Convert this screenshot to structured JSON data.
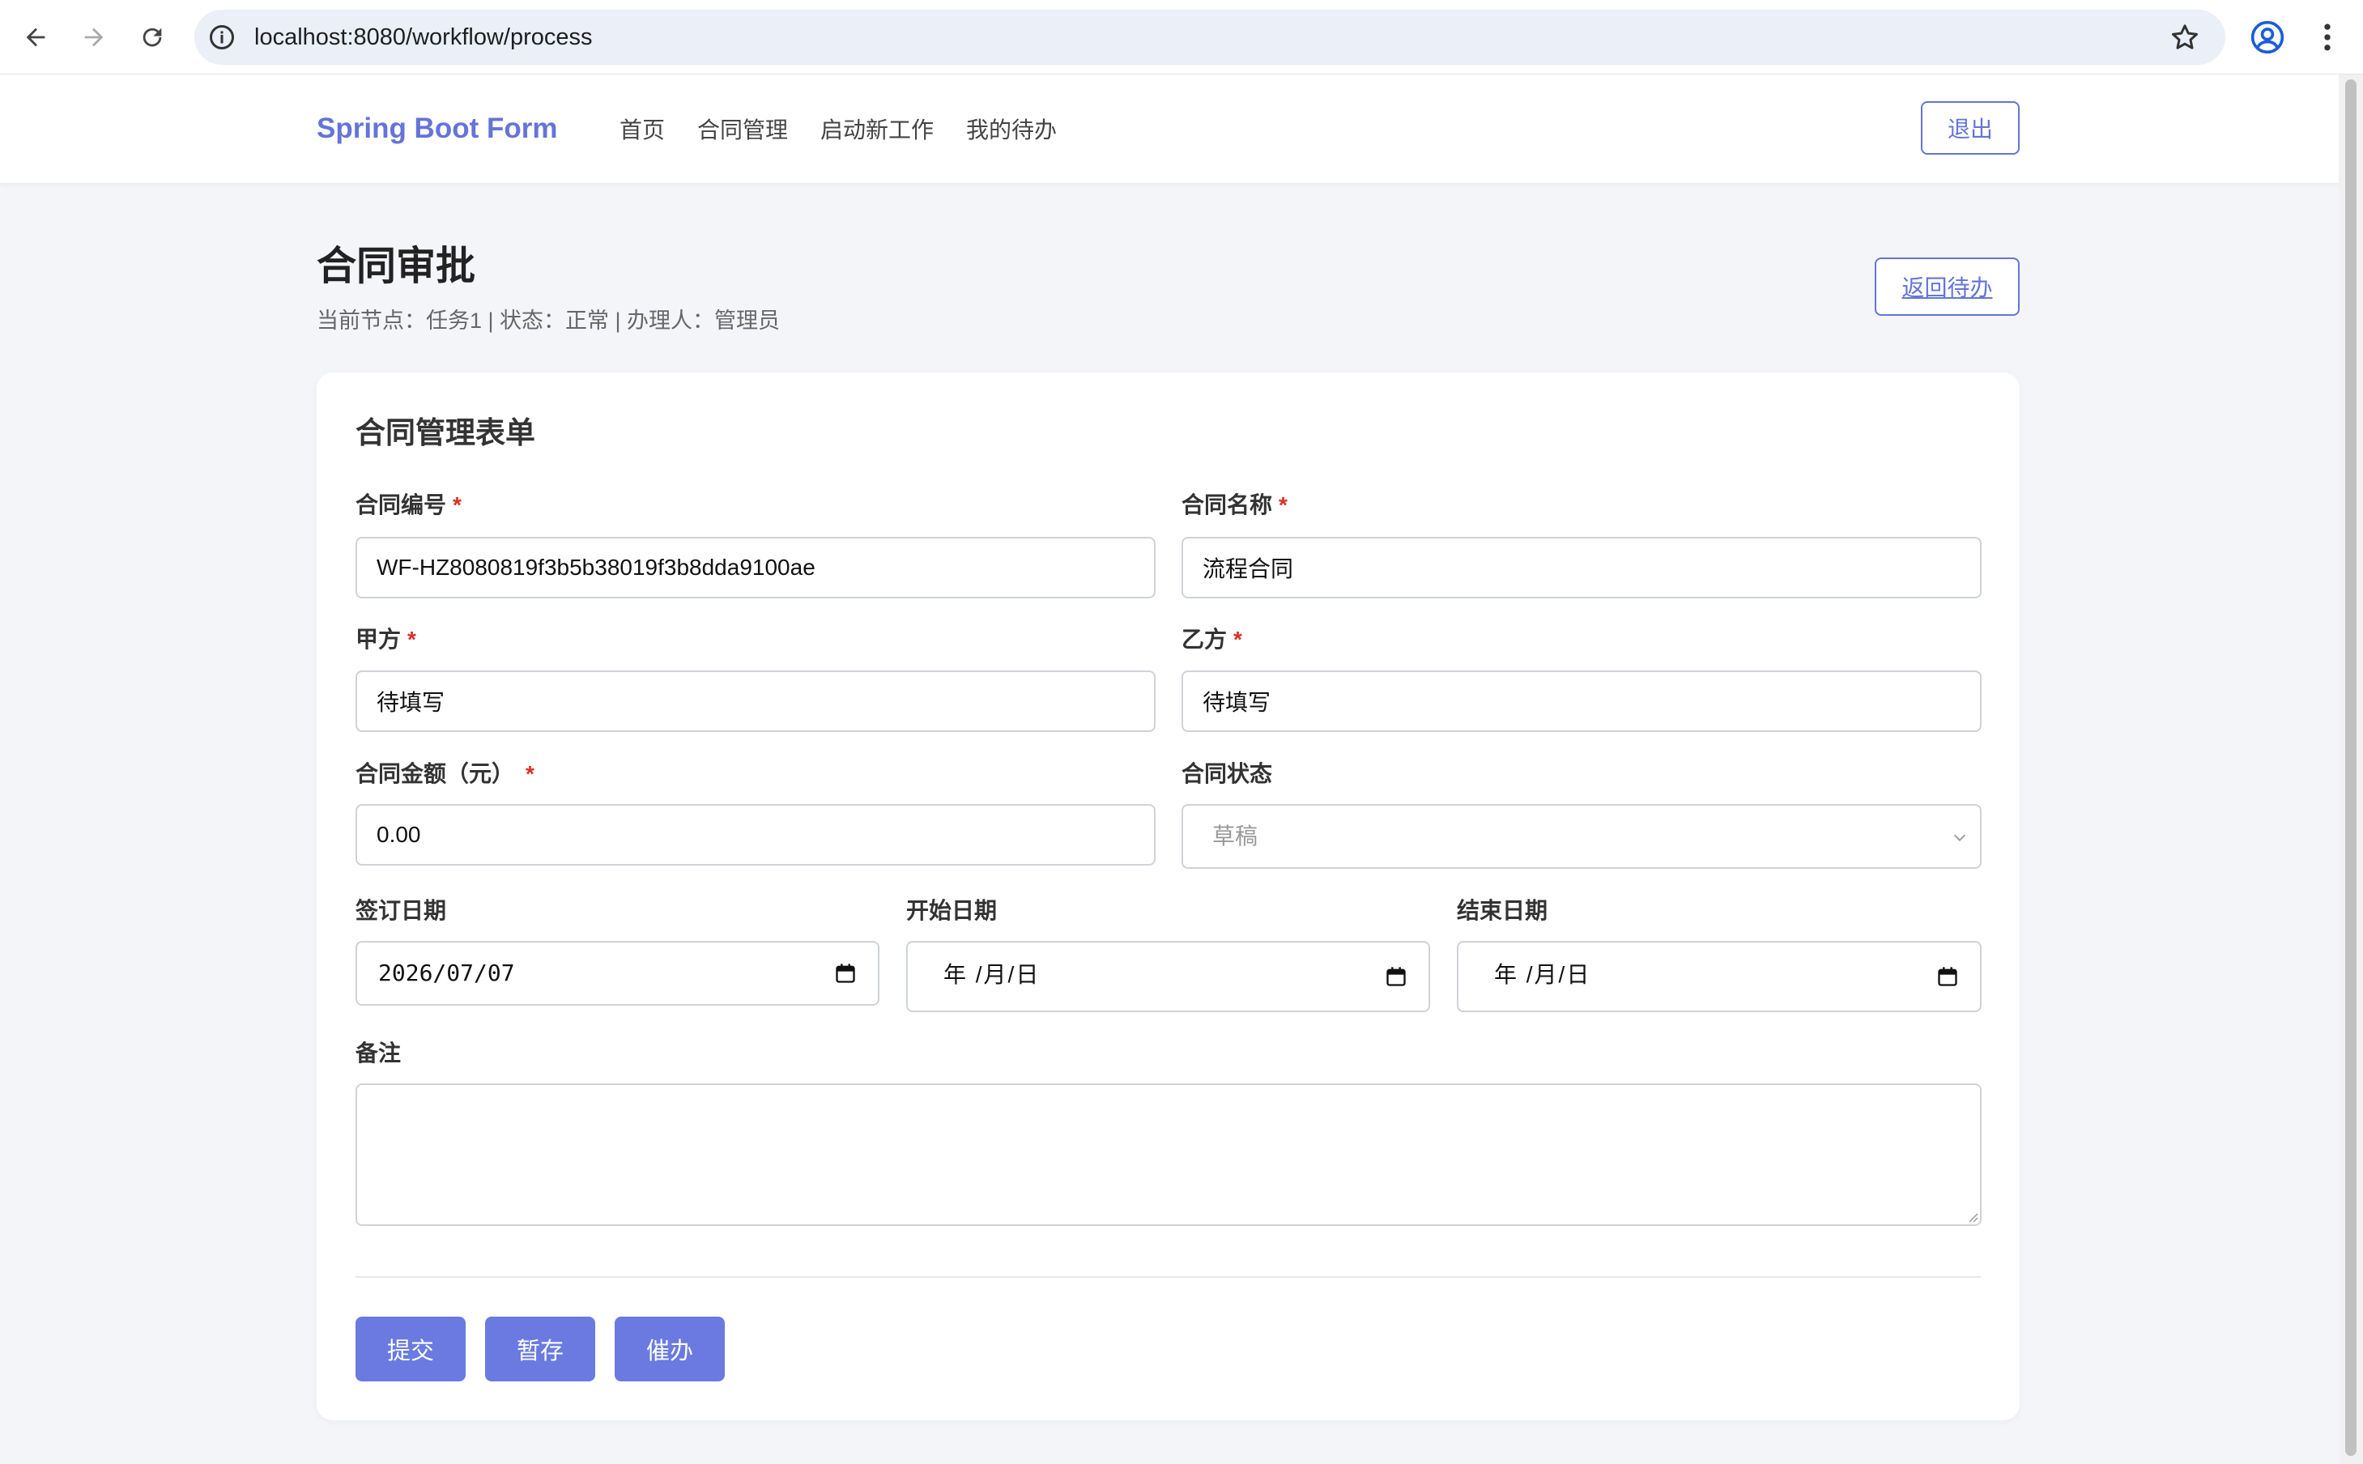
{
  "browser": {
    "url": "localhost:8080/workflow/process"
  },
  "header": {
    "brand": "Spring Boot Form",
    "nav": [
      {
        "label": "首页"
      },
      {
        "label": "合同管理"
      },
      {
        "label": "启动新工作"
      },
      {
        "label": "我的待办"
      }
    ],
    "logout_label": "退出",
    "brand_color": "#6474d8"
  },
  "page": {
    "title": "合同审批",
    "subtitle": "当前节点：任务1 | 状态：正常 | 办理人：管理员",
    "back_label": "返回待办"
  },
  "form": {
    "title": "合同管理表单",
    "required_mark": "*",
    "contract_no": {
      "label": "合同编号",
      "value": "WF-HZ8080819f3b5b38019f3b8dda9100ae"
    },
    "contract_name": {
      "label": "合同名称",
      "value": "流程合同"
    },
    "party_a": {
      "label": "甲方",
      "value": "待填写"
    },
    "party_b": {
      "label": "乙方",
      "value": "待填写"
    },
    "amount": {
      "label": "合同金额（元）",
      "value": "0.00"
    },
    "status": {
      "label": "合同状态",
      "value": "草稿"
    },
    "sign_date": {
      "label": "签订日期",
      "value": "2026/07/07"
    },
    "start_date": {
      "label": "开始日期",
      "placeholder": "年 /月/日"
    },
    "end_date": {
      "label": "结束日期",
      "placeholder": "年 /月/日"
    },
    "remark": {
      "label": "备注",
      "value": ""
    },
    "buttons": {
      "submit": "提交",
      "save": "暂存",
      "urge": "催办"
    },
    "button_color": "#6a7ae0"
  }
}
